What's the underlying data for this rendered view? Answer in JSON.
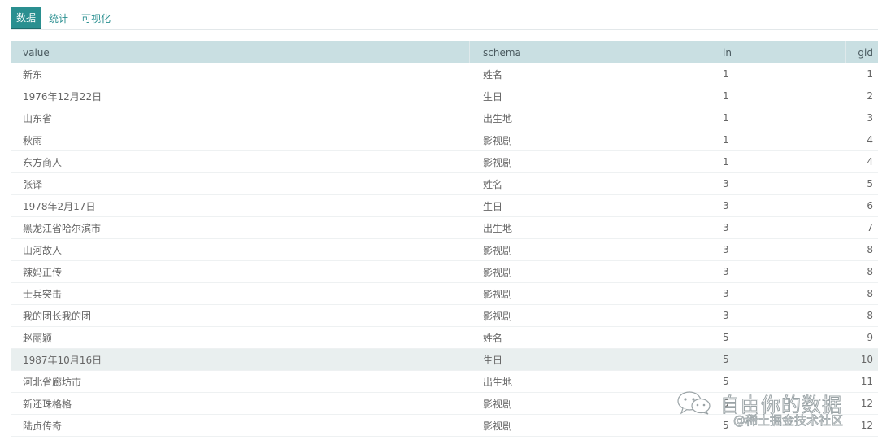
{
  "tabs": [
    {
      "label": "数据",
      "active": true
    },
    {
      "label": "统计",
      "active": false
    },
    {
      "label": "可视化",
      "active": false
    }
  ],
  "table": {
    "columns": [
      "value",
      "schema",
      "ln",
      "gid"
    ],
    "rows": [
      [
        "新东",
        "姓名",
        "1",
        "1"
      ],
      [
        "1976年12月22日",
        "生日",
        "1",
        "2"
      ],
      [
        "山东省",
        "出生地",
        "1",
        "3"
      ],
      [
        "秋雨",
        "影视剧",
        "1",
        "4"
      ],
      [
        "东方商人",
        "影视剧",
        "1",
        "4"
      ],
      [
        "张译",
        "姓名",
        "3",
        "5"
      ],
      [
        "1978年2月17日",
        "生日",
        "3",
        "6"
      ],
      [
        "黑龙江省哈尔滨市",
        "出生地",
        "3",
        "7"
      ],
      [
        "山河故人",
        "影视剧",
        "3",
        "8"
      ],
      [
        "辣妈正传",
        "影视剧",
        "3",
        "8"
      ],
      [
        "士兵突击",
        "影视剧",
        "3",
        "8"
      ],
      [
        "我的团长我的团",
        "影视剧",
        "3",
        "8"
      ],
      [
        "赵丽颖",
        "姓名",
        "5",
        "9"
      ],
      [
        "1987年10月16日",
        "生日",
        "5",
        "10"
      ],
      [
        "河北省廊坊市",
        "出生地",
        "5",
        "11"
      ],
      [
        "新还珠格格",
        "影视剧",
        "5",
        "12"
      ],
      [
        "陆贞传奇",
        "影视剧",
        "5",
        "12"
      ]
    ],
    "highlighted_row": 13
  },
  "watermark": {
    "title": "自由你的数据",
    "subtitle": "@稀土掘金技术社区",
    "icon": "wechat-icon"
  },
  "colors": {
    "accent": "#2a8f90",
    "header_bg": "#c9dfe2",
    "highlight_bg": "#e9efef"
  }
}
